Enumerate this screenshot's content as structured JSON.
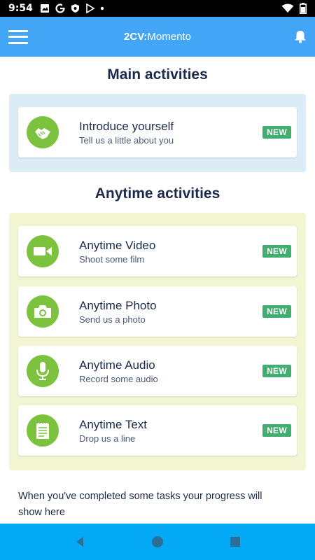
{
  "status_bar": {
    "time": "9:54"
  },
  "app_bar": {
    "logo_brand": "2CV:",
    "logo_product": "Momento"
  },
  "main": {
    "title": "Main activities",
    "items": [
      {
        "title": "Introduce yourself",
        "subtitle": "Tell us a little about you",
        "badge": "NEW",
        "icon": "handshake-icon"
      }
    ]
  },
  "anytime": {
    "title": "Anytime activities",
    "items": [
      {
        "title": "Anytime Video",
        "subtitle": "Shoot some film",
        "badge": "NEW",
        "icon": "video-camera-icon"
      },
      {
        "title": "Anytime Photo",
        "subtitle": "Send us a photo",
        "badge": "NEW",
        "icon": "camera-icon"
      },
      {
        "title": "Anytime Audio",
        "subtitle": "Record some audio",
        "badge": "NEW",
        "icon": "microphone-icon"
      },
      {
        "title": "Anytime Text",
        "subtitle": "Drop us a line",
        "badge": "NEW",
        "icon": "notepad-icon"
      }
    ]
  },
  "progress": {
    "text": "When you've completed some tasks your progress will show here"
  },
  "colors": {
    "app_bar": "#42a5f5",
    "nav_bar": "#03a9f4",
    "icon_green": "#7dc23f",
    "badge_green": "#3fae6e",
    "main_panel": "#dcecf7",
    "anytime_panel": "#f2f5d2"
  }
}
